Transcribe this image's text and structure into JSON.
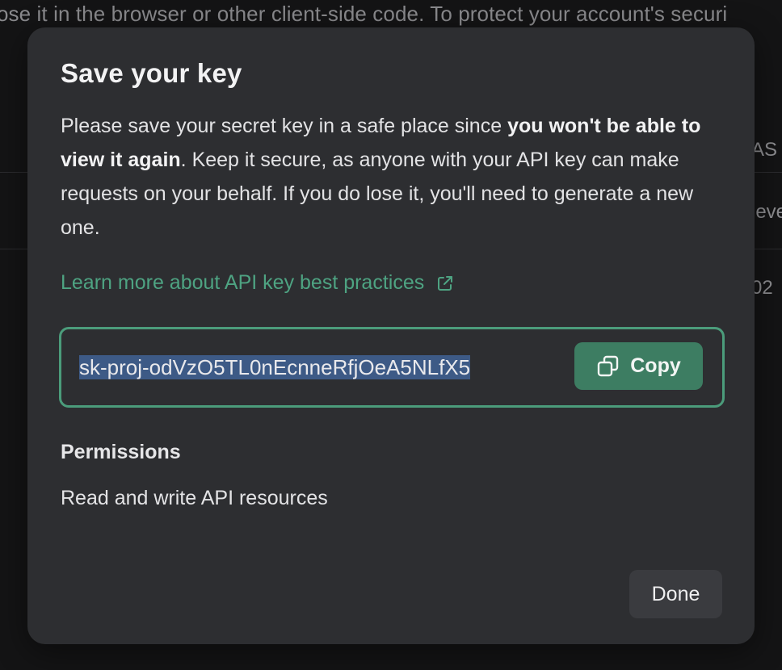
{
  "background": {
    "top_text": "ose it in the browser or other client-side code. To protect your account's securi",
    "column_header_fragment": "AS",
    "row1_fragment": "leve",
    "row2_fragment": "02"
  },
  "modal": {
    "title": "Save your key",
    "body": {
      "text_before_bold": "Please save your secret key in a safe place since ",
      "bold_text": "you won't be able to view it again",
      "text_after_bold": ". Keep it secure, as anyone with your API key can make requests on your behalf. If you do lose it, you'll need to generate a new one."
    },
    "learn_more_link": "Learn more about API key best practices",
    "learn_more_icon": "external-link-icon",
    "api_key_value": "sk-proj-odVzO5TL0nEcnneRfjOeA5NLfX5",
    "copy_button_label": "Copy",
    "copy_icon": "copy-icon",
    "permissions_heading": "Permissions",
    "permissions_value": "Read and write API resources",
    "done_button_label": "Done"
  },
  "colors": {
    "accent_green": "#4ea382",
    "copy_button_bg": "#3d7d62",
    "selection_highlight": "#3d5a86",
    "modal_bg": "#2d2e31"
  }
}
